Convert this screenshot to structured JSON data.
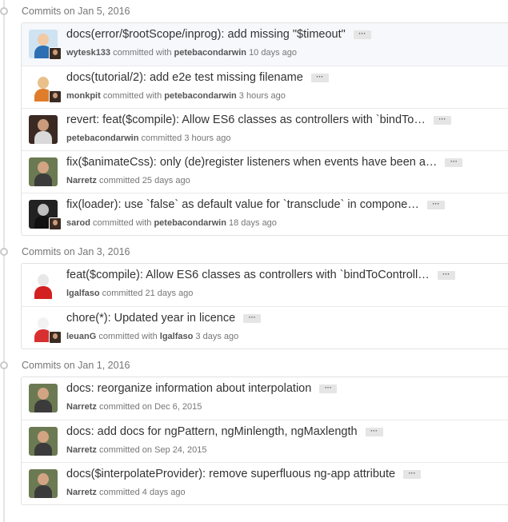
{
  "groups": [
    {
      "header": "Commits on Jan 5, 2016",
      "commits": [
        {
          "message": "docs(error/$rootScope/inprog): add missing \"$timeout\"",
          "author": "wytesk133",
          "verb": "committed with",
          "committer": "petebacondarwin",
          "time": "10 days ago",
          "avatar": "cartoon-avatar",
          "colors": {
            "bg": "#cfe3f2",
            "head": "#f1c9a5",
            "body": "#2c6fb3"
          },
          "sub": true
        },
        {
          "message": "docs(tutorial/2): add e2e test missing filename",
          "author": "monkpit",
          "verb": "committed with",
          "committer": "petebacondarwin",
          "time": "3 hours ago",
          "avatar": "monk-avatar",
          "colors": {
            "bg": "#ffffff",
            "head": "#e9c08a",
            "body": "#e07d2a"
          },
          "sub": true
        },
        {
          "message": "revert: feat($compile): Allow ES6 classes as controllers with `bindTo…",
          "author": "petebacondarwin",
          "verb": "committed",
          "committer": "",
          "time": "3 hours ago",
          "avatar": "photo-avatar",
          "colors": {
            "bg": "#3a2a22",
            "head": "#c99b7c",
            "body": "#d9d9d9"
          },
          "sub": false
        },
        {
          "message": "fix($animateCss): only (de)register listeners when events have been a…",
          "author": "Narretz",
          "verb": "committed",
          "committer": "",
          "time": "25 days ago",
          "avatar": "photo-avatar",
          "colors": {
            "bg": "#6b7a52",
            "head": "#d2a483",
            "body": "#3b3b3b"
          },
          "sub": false
        },
        {
          "message": "fix(loader): use `false` as default value for `transclude` in compone…",
          "author": "sarod",
          "verb": "committed with",
          "committer": "petebacondarwin",
          "time": "18 days ago",
          "avatar": "photo-avatar",
          "colors": {
            "bg": "#222222",
            "head": "#bfbfbf",
            "body": "#111111"
          },
          "sub": true
        }
      ]
    },
    {
      "header": "Commits on Jan 3, 2016",
      "commits": [
        {
          "message": "feat($compile): Allow ES6 classes as controllers with `bindToControll…",
          "author": "lgalfaso",
          "verb": "committed",
          "committer": "",
          "time": "21 days ago",
          "avatar": "can-avatar",
          "colors": {
            "bg": "#ffffff",
            "head": "#e8e8e8",
            "body": "#d32020"
          },
          "sub": false
        },
        {
          "message": "chore(*): Updated year in licence",
          "author": "leuanG",
          "verb": "committed with",
          "committer": "lgalfaso",
          "time": "3 days ago",
          "avatar": "hat-avatar",
          "colors": {
            "bg": "#ffffff",
            "head": "#f2f2f2",
            "body": "#d83030"
          },
          "sub": true
        }
      ]
    },
    {
      "header": "Commits on Jan 1, 2016",
      "commits": [
        {
          "message": "docs: reorganize information about interpolation",
          "author": "Narretz",
          "verb": "committed on",
          "committer": "",
          "time": "Dec 6, 2015",
          "avatar": "photo-avatar",
          "colors": {
            "bg": "#6b7a52",
            "head": "#d2a483",
            "body": "#3b3b3b"
          },
          "sub": false
        },
        {
          "message": "docs: add docs for ngPattern, ngMinlength, ngMaxlength",
          "author": "Narretz",
          "verb": "committed on",
          "committer": "",
          "time": "Sep 24, 2015",
          "avatar": "photo-avatar",
          "colors": {
            "bg": "#6b7a52",
            "head": "#d2a483",
            "body": "#3b3b3b"
          },
          "sub": false
        },
        {
          "message": "docs($interpolateProvider): remove superfluous ng-app attribute",
          "author": "Narretz",
          "verb": "committed",
          "committer": "",
          "time": "4 days ago",
          "avatar": "photo-avatar",
          "colors": {
            "bg": "#6b7a52",
            "head": "#d2a483",
            "body": "#3b3b3b"
          },
          "sub": false
        }
      ]
    }
  ],
  "ellipsis_label": "···",
  "sub_avatar_colors": {
    "bg": "#3a2a22",
    "head": "#c99b7c"
  }
}
